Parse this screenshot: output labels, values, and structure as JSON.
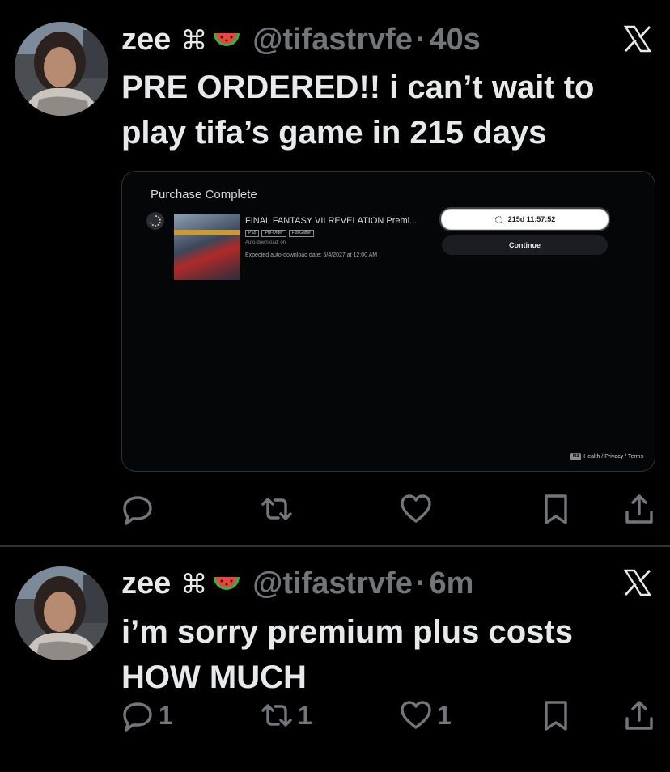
{
  "tweets": [
    {
      "name": "zee",
      "name_emoji": "⌘",
      "handle": "@tifastrvfe",
      "time": "40s",
      "text": "PRE ORDERED!! i can’t wait to\nplay tifa’s game in 215 days",
      "counts": {
        "reply": "",
        "retweet": "",
        "like": ""
      },
      "media": {
        "title": "Purchase Complete",
        "game_title": "FINAL FANTASY VII REVELATION Premi...",
        "tags": [
          "PS5",
          "Pre-Order",
          "Full Game"
        ],
        "auto_download": "Auto-download: on",
        "expected": "Expected auto-download date: 5/4/2027 at 12:00 AM",
        "timer": "215d 11:57:52",
        "continue": "Continue",
        "footer": "Health / Privacy / Terms",
        "footer_badge": "R3"
      }
    },
    {
      "name": "zee",
      "name_emoji": "⌘",
      "handle": "@tifastrvfe",
      "time": "6m",
      "text": "i’m sorry premium plus costs\nHOW MUCH",
      "counts": {
        "reply": "1",
        "retweet": "1",
        "like": "1"
      }
    }
  ],
  "colors": {
    "background": "#000000",
    "text": "#e7e9ea",
    "muted": "#71767b",
    "divider": "#2f3336"
  },
  "icons": [
    "reply-icon",
    "retweet-icon",
    "like-icon",
    "bookmark-icon",
    "share-icon",
    "x-logo-icon",
    "watermelon-emoji-icon"
  ]
}
